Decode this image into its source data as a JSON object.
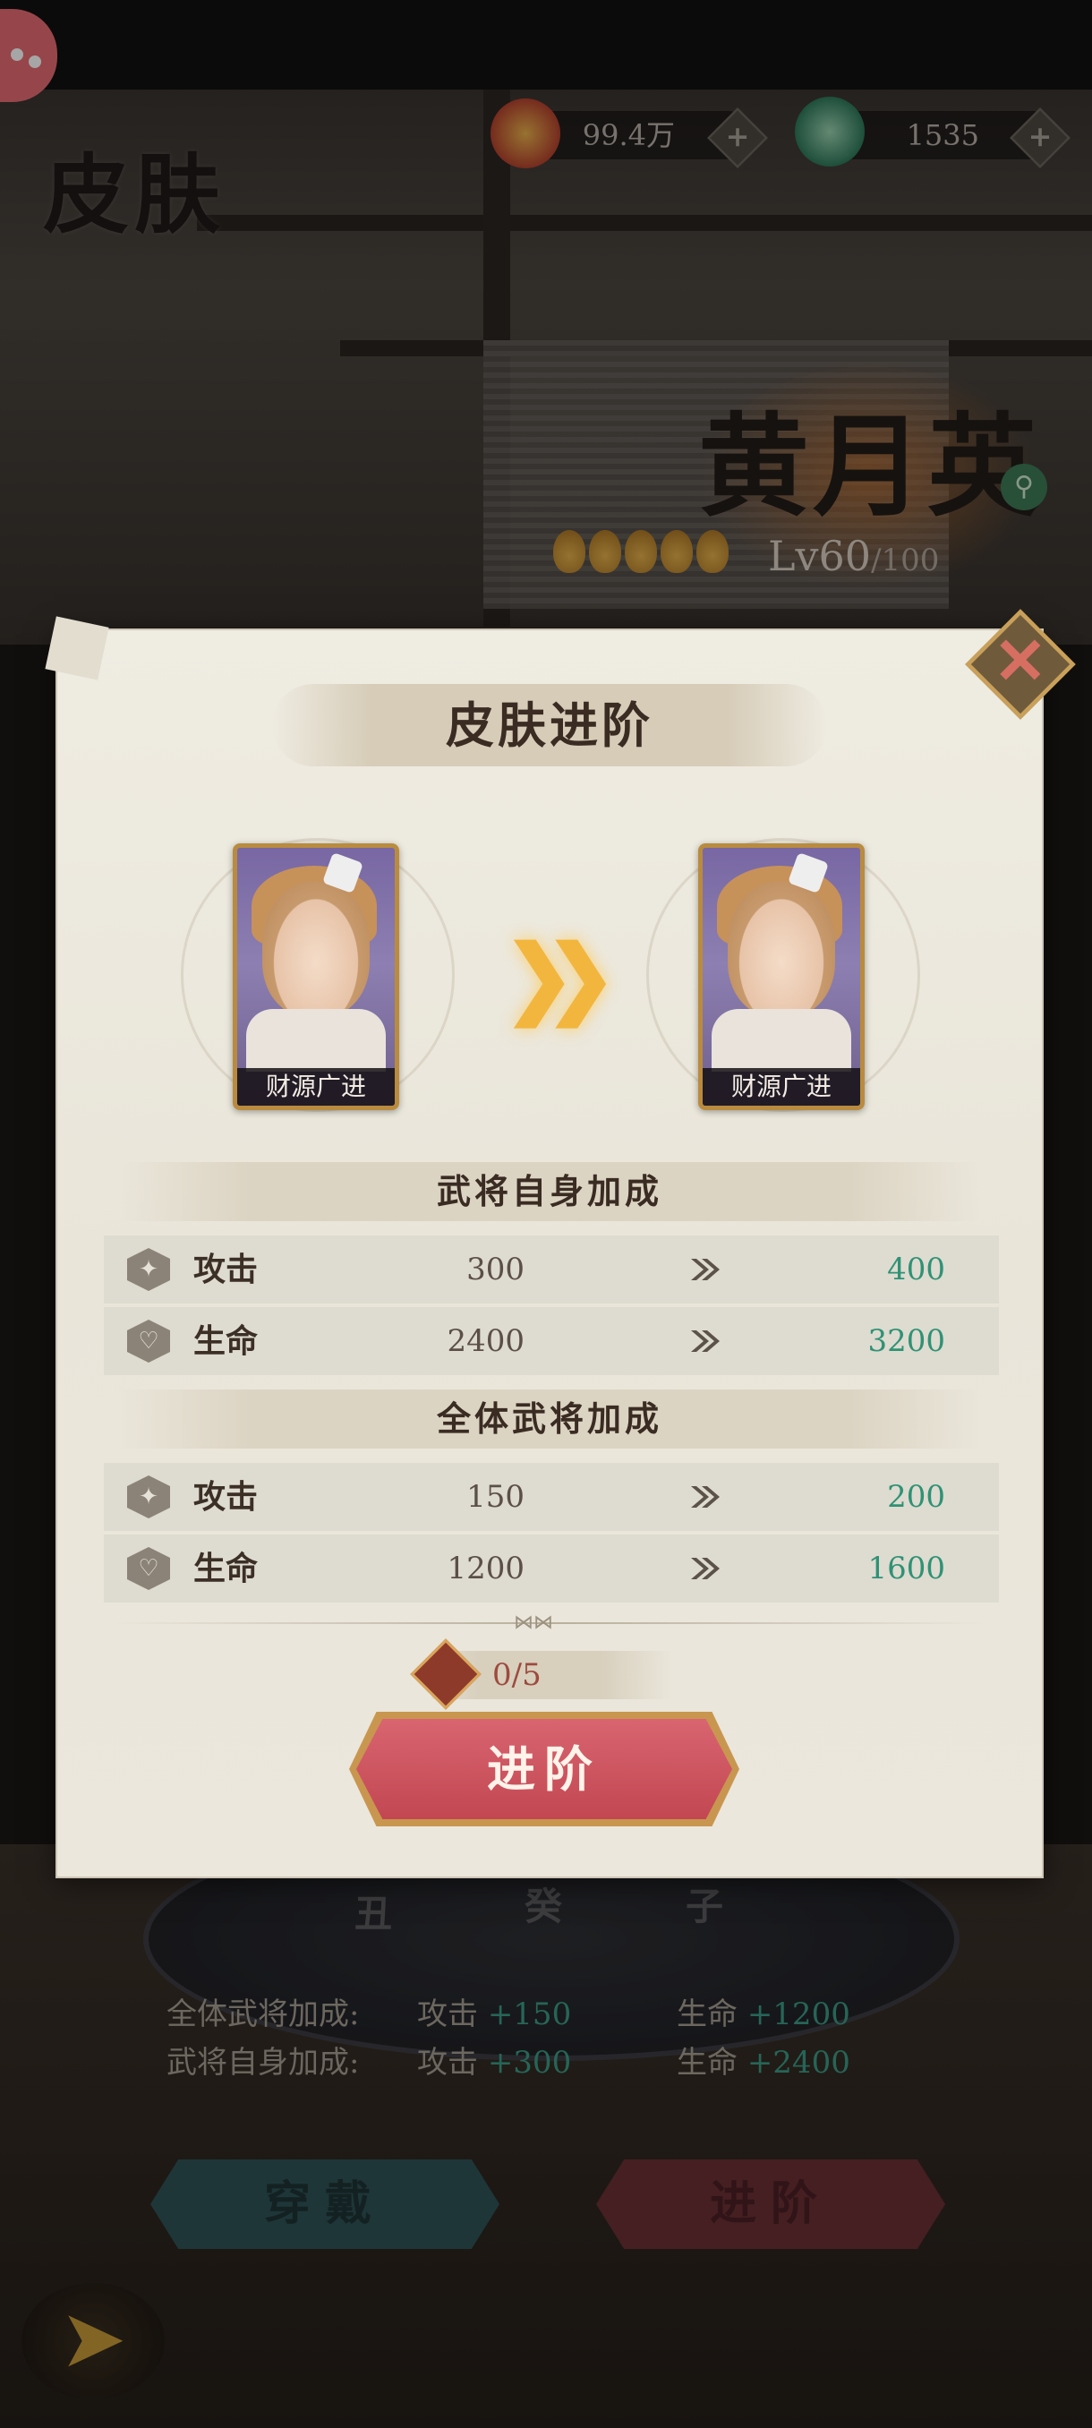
{
  "page": {
    "title": "皮肤"
  },
  "resources": [
    {
      "name": "copper-coin",
      "value": "99.4万"
    },
    {
      "name": "jade",
      "value": "1535"
    }
  ],
  "hero": {
    "name": "黄月英",
    "level": "Lv60",
    "level_max": "/100",
    "stars": 5
  },
  "background_stats": {
    "row1": {
      "label": "全体武将加成:",
      "atk_label": "攻击",
      "atk_value": "+150",
      "hp_label": "生命",
      "hp_value": "+1200"
    },
    "row2": {
      "label": "武将自身加成:",
      "atk_label": "攻击",
      "atk_value": "+300",
      "hp_label": "生命",
      "hp_value": "+2400"
    }
  },
  "background_buttons": {
    "wear": "穿戴",
    "advance": "进阶"
  },
  "compass_glyphs": [
    "丑",
    "癸",
    "子"
  ],
  "modal": {
    "title": "皮肤进阶",
    "card_from": {
      "label": "财源广进"
    },
    "card_to": {
      "label": "财源广进"
    },
    "sections": [
      {
        "title": "武将自身加成",
        "rows": [
          {
            "name": "攻击",
            "from": "300",
            "to": "400"
          },
          {
            "name": "生命",
            "from": "2400",
            "to": "3200"
          }
        ]
      },
      {
        "title": "全体武将加成",
        "rows": [
          {
            "name": "攻击",
            "from": "150",
            "to": "200"
          },
          {
            "name": "生命",
            "from": "1200",
            "to": "1600"
          }
        ]
      }
    ],
    "cost": "0/5",
    "advance_button": "进阶"
  },
  "colors": {
    "increase_green": "#2f9275",
    "button_red": "#c24752",
    "gold_border": "#c99650"
  }
}
